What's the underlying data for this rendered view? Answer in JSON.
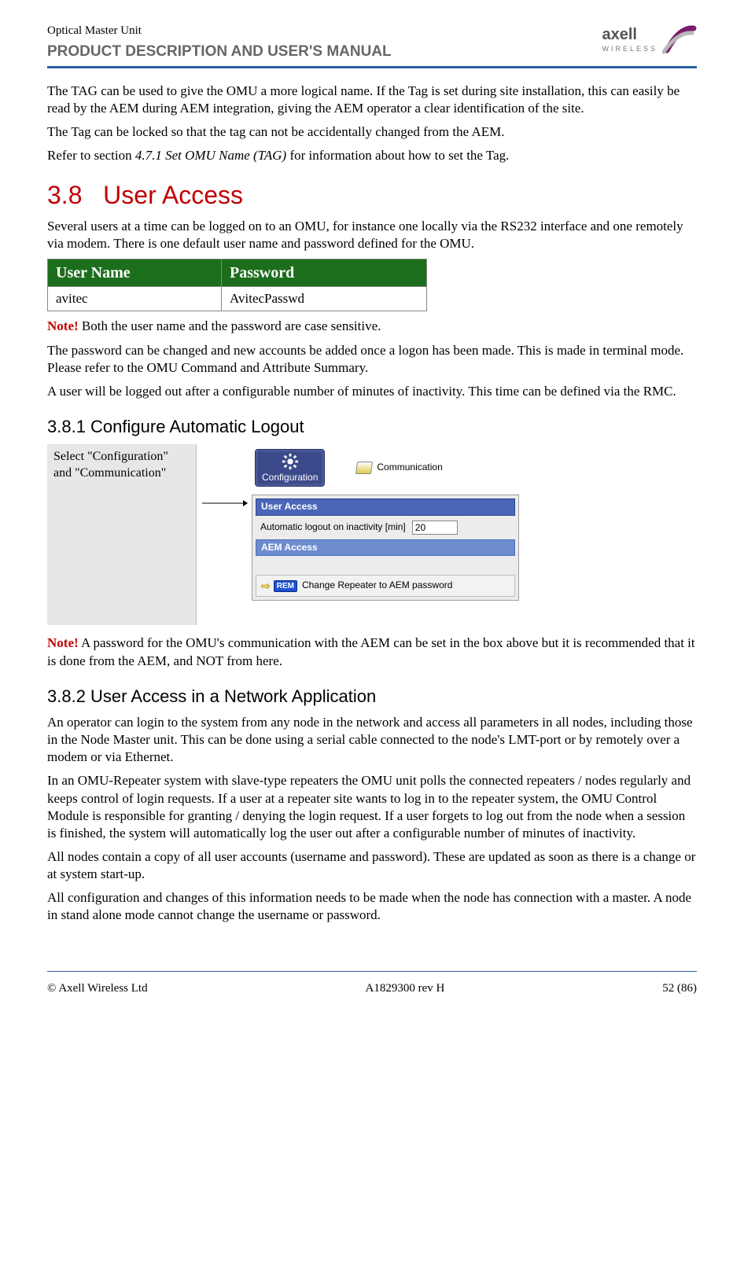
{
  "header": {
    "product": "Optical Master Unit",
    "subtitle": "PRODUCT DESCRIPTION AND USER'S MANUAL",
    "brand_main": "axell",
    "brand_sub": "WIRELESS"
  },
  "paras": {
    "p1": "The TAG can be used to give the OMU a more logical name. If the Tag is set during site installation, this can easily be read by the AEM during AEM integration, giving the AEM operator a clear identification of the site.",
    "p2": "The Tag can be locked so that the tag can not be accidentally changed from the AEM.",
    "p3a": "Refer to section ",
    "p3i": "4.7.1 Set OMU Name (TAG)",
    "p3b": " for information about how to set the Tag."
  },
  "sec38": {
    "num": "3.8",
    "title": "User Access",
    "intro": "Several users at a time can be logged on to an OMU, for instance one locally via the RS232 interface and one remotely via modem. There is one default user name and password defined for the OMU.",
    "table": {
      "h1": "User Name",
      "h2": "Password",
      "r1c1": "avitec",
      "r1c2": "AvitecPasswd"
    },
    "note1_label": "Note!",
    "note1_text": " Both the user name and the password are case sensitive.",
    "p_after1": "The password can be changed and new accounts be added once a logon has been made. This is made in terminal mode. Please refer to the OMU Command and Attribute Summary.",
    "p_after2": "A user will be logged out after a configurable number of minutes of inactivity. This time can be defined via the RMC."
  },
  "sec381": {
    "heading": "3.8.1 Configure Automatic Logout",
    "figlabel": "Select \"Configuration\" and \"Communication\"",
    "mock": {
      "config_label": "Configuration",
      "comm_label": "Communication",
      "panel_user_access": "User Access",
      "row_label": "Automatic logout on inactivity [min]",
      "row_value": "20",
      "panel_aem": "AEM Access",
      "rem_label": "REM",
      "footer_text": "Change Repeater to AEM password"
    },
    "note_label": "Note!",
    "note_text": " A password for the OMU's communication with the AEM can be set in the box above but it is recommended that it is done from the AEM, and NOT from here."
  },
  "sec382": {
    "heading": "3.8.2 User Access in a Network Application",
    "p1": "An operator can login to the system from any node in the network and access all parameters in all nodes, including those in the Node Master unit. This can be done using a serial cable connected to the node's LMT-port or by remotely over a modem or via Ethernet.",
    "p2": "In an OMU-Repeater system with slave-type repeaters the OMU unit polls the connected repeaters / nodes regularly and keeps control of login requests. If a user at a repeater site wants to log in to the repeater system, the OMU Control Module is responsible for granting / denying the login request. If a user forgets to log out from the node when a session is finished, the system will automatically log the user out after a configurable number of minutes of inactivity.",
    "p3": "All nodes contain a copy of all user accounts (username and password). These are updated as soon as there is a change or at system start-up.",
    "p4": "All configuration and changes of this information needs to be made when the node has connection with a master. A node in stand alone mode cannot change the username or password."
  },
  "footer": {
    "left": "© Axell Wireless Ltd",
    "center": "A1829300 rev H",
    "right": "52 (86)"
  }
}
